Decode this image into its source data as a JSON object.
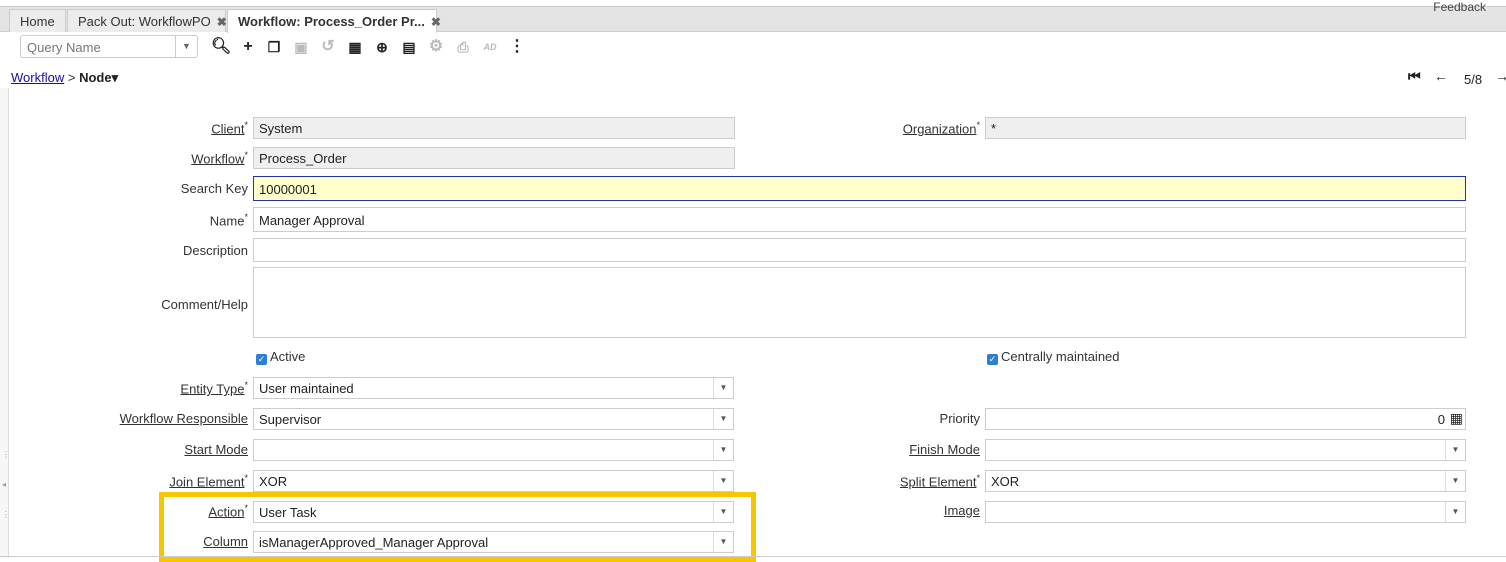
{
  "header": {
    "feedback": "Feedback"
  },
  "tabs": [
    {
      "label": "Home"
    },
    {
      "label": "Pack Out: WorkflowPO",
      "close": "✖"
    },
    {
      "label": "Workflow: Process_Order Pr...",
      "close": "✖"
    }
  ],
  "toolbar": {
    "query_placeholder": "Query Name",
    "icons": [
      "search-icon",
      "new-record-icon",
      "copy-icon",
      "save-icon",
      "undo-icon",
      "grid-toggle-icon",
      "zoom-icon",
      "report-icon",
      "process-gear-icon",
      "print-icon",
      "archive-icon",
      "more-menu-icon"
    ]
  },
  "breadcrumb": {
    "parent": "Workflow",
    "sep": ">",
    "current": "Node▾"
  },
  "record_nav": {
    "position": "5/8"
  },
  "form": {
    "client": {
      "label": "Client",
      "value": "System"
    },
    "organization": {
      "label": "Organization",
      "value": "*"
    },
    "workflow": {
      "label": "Workflow",
      "value": "Process_Order"
    },
    "search_key": {
      "label": "Search Key",
      "value": "10000001"
    },
    "name": {
      "label": "Name",
      "value": "Manager Approval"
    },
    "description": {
      "label": "Description",
      "value": ""
    },
    "comment": {
      "label": "Comment/Help",
      "value": ""
    },
    "active": {
      "label": "Active",
      "checked": true
    },
    "centrally": {
      "label": "Centrally maintained",
      "checked": true
    },
    "entity_type": {
      "label": "Entity Type",
      "value": "User maintained"
    },
    "responsible": {
      "label": "Workflow Responsible",
      "value": "Supervisor"
    },
    "priority": {
      "label": "Priority",
      "value": "0"
    },
    "start_mode": {
      "label": "Start Mode",
      "value": ""
    },
    "finish_mode": {
      "label": "Finish Mode",
      "value": ""
    },
    "join": {
      "label": "Join Element",
      "value": "XOR"
    },
    "split": {
      "label": "Split Element",
      "value": "XOR"
    },
    "action": {
      "label": "Action",
      "value": "User Task"
    },
    "image": {
      "label": "Image",
      "value": ""
    },
    "column": {
      "label": "Column",
      "value": "isManagerApproved_Manager Approval"
    }
  },
  "highlight_color": "#f7c600"
}
